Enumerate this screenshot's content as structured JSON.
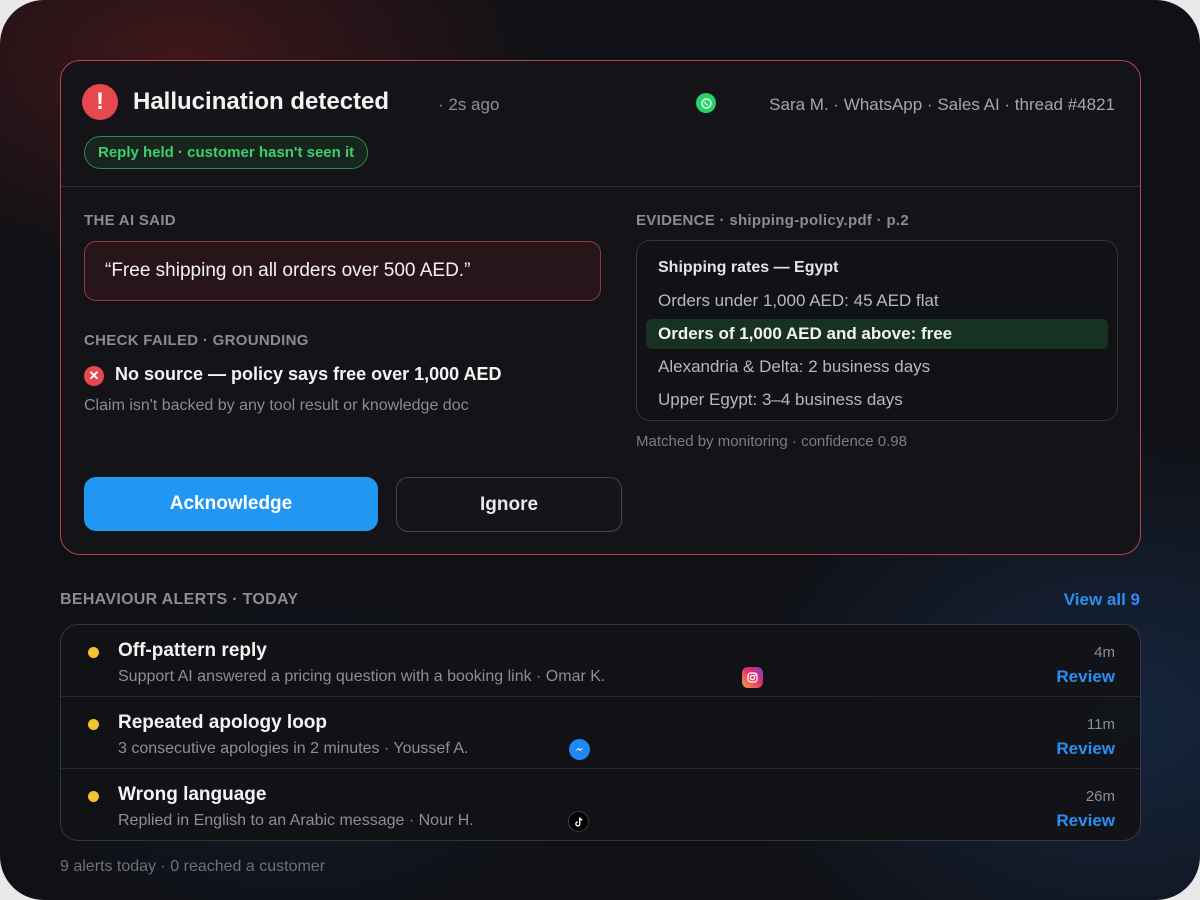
{
  "alert": {
    "icon": "exclamation-icon",
    "icon_glyph": "!",
    "title": "Hallucination detected",
    "time": "· 2s ago",
    "channel_icon": "whatsapp-icon",
    "meta": "Sara M. · WhatsApp · Sales AI · thread #4821",
    "badge": "Reply held · customer hasn't seen it"
  },
  "ai_said": {
    "label": "THE AI SAID",
    "quote": "“Free shipping on all orders over 500 AED.”"
  },
  "check": {
    "label": "CHECK FAILED · GROUNDING",
    "icon_glyph": "✕",
    "title": "No source — policy says free over 1,000 AED",
    "description": "Claim isn't backed by any tool result or knowledge doc"
  },
  "evidence": {
    "label": "EVIDENCE · shipping-policy.pdf · p.2",
    "heading": "Shipping rates — Egypt",
    "lines": [
      "Orders under 1,000 AED: 45 AED flat",
      "Orders of 1,000 AED and above: free",
      "Alexandria & Delta: 2 business days",
      "Upper Egypt: 3–4 business days"
    ],
    "highlighted_index": 1,
    "match_note": "Matched by monitoring · confidence 0.98"
  },
  "actions": {
    "acknowledge": "Acknowledge",
    "ignore": "Ignore"
  },
  "behaviour": {
    "label": "BEHAVIOUR ALERTS · TODAY",
    "view_all": "View all 9",
    "review_label": "Review",
    "items": [
      {
        "title": "Off-pattern reply",
        "description": "Support AI answered a pricing question with a booking link · Omar K.",
        "time": "4m",
        "channel_icon": "instagram-icon"
      },
      {
        "title": "Repeated apology loop",
        "description": "3 consecutive apologies in 2 minutes · Youssef A.",
        "time": "11m",
        "channel_icon": "messenger-icon"
      },
      {
        "title": "Wrong language",
        "description": "Replied in English to an Arabic message · Nour H.",
        "time": "26m",
        "channel_icon": "tiktok-icon"
      }
    ]
  },
  "footer": "9 alerts today · 0 reached a customer",
  "colors": {
    "danger": "#e5484d",
    "accent": "#2196f3",
    "success": "#3ccf6a",
    "warning": "#f2c230"
  }
}
